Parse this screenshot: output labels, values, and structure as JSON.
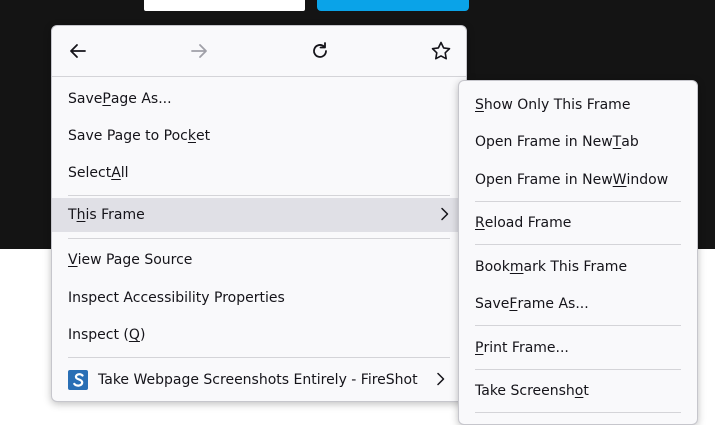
{
  "colors": {
    "page_dark": "#141414",
    "accent_blue": "#0aa3e8",
    "menu_bg": "#f9f9fb",
    "highlight": "#e0e0e6"
  },
  "nav": {
    "back_icon": "arrow-left-icon",
    "forward_icon": "arrow-right-icon",
    "reload_icon": "reload-icon",
    "bookmark_icon": "star-icon"
  },
  "main_menu": {
    "save_page_as": {
      "a": "Save ",
      "u": "P",
      "b": "age As..."
    },
    "save_to_pocket": {
      "a": "Save Page to Poc",
      "u": "k",
      "b": "et"
    },
    "select_all": {
      "a": "Select ",
      "u": "A",
      "b": "ll"
    },
    "this_frame": {
      "a": "T",
      "u": "h",
      "b": "is Frame"
    },
    "view_source": {
      "a": "",
      "u": "V",
      "b": "iew Page Source"
    },
    "inspect_a11y": {
      "a": "Inspect Accessibility Properties",
      "u": "",
      "b": ""
    },
    "inspect": {
      "a": "Inspect (",
      "u": "Q",
      "b": ")"
    },
    "fireshot": {
      "label": "Take Webpage Screenshots Entirely - FireShot",
      "icon": "fireshot-icon"
    }
  },
  "sub_menu": {
    "show_only": {
      "a": "",
      "u": "S",
      "b": "how Only This Frame"
    },
    "new_tab": {
      "a": "Open Frame in New ",
      "u": "T",
      "b": "ab"
    },
    "new_window": {
      "a": "Open Frame in New ",
      "u": "W",
      "b": "indow"
    },
    "reload": {
      "a": "",
      "u": "R",
      "b": "eload Frame"
    },
    "bookmark": {
      "a": "Book",
      "u": "m",
      "b": "ark This Frame"
    },
    "save_frame": {
      "a": "Save ",
      "u": "F",
      "b": "rame As..."
    },
    "print": {
      "a": "",
      "u": "P",
      "b": "rint Frame..."
    },
    "screenshot": {
      "a": "Take Screensh",
      "u": "o",
      "b": "t"
    }
  }
}
